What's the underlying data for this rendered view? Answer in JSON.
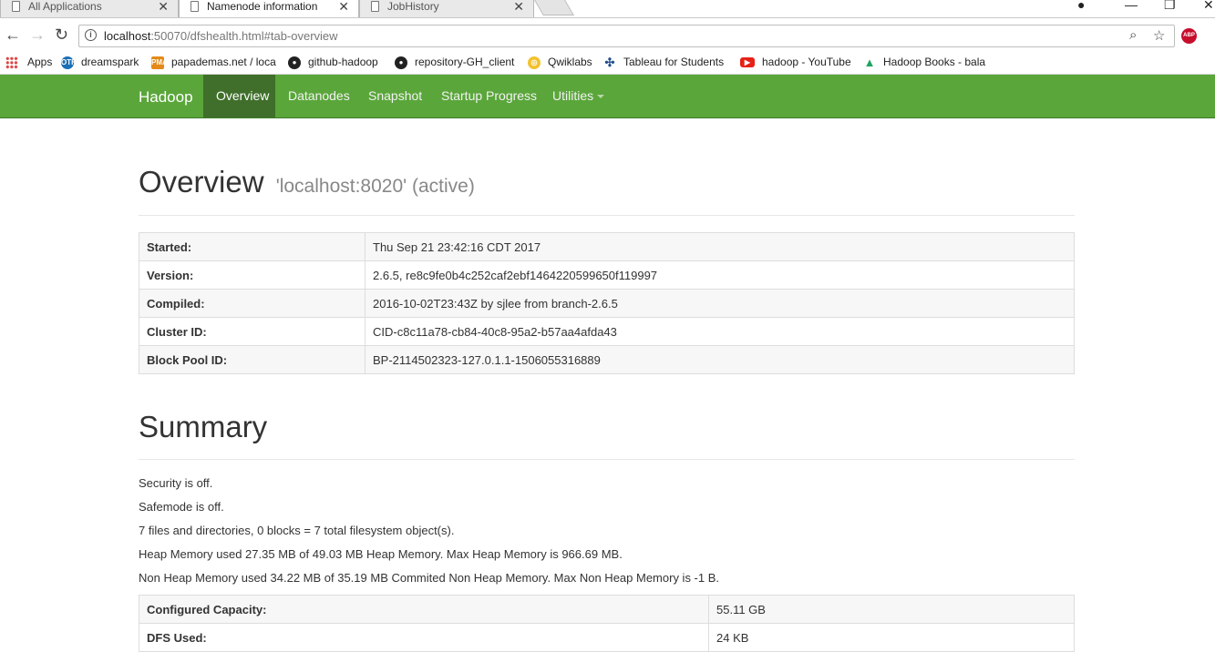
{
  "browser": {
    "tabs": [
      {
        "title": "All Applications",
        "active": false
      },
      {
        "title": "Namenode information",
        "active": true
      },
      {
        "title": "JobHistory",
        "active": false
      }
    ],
    "url_host": "localhost",
    "url_path": ":50070/dfshealth.html#tab-overview",
    "abp_label": "ABP",
    "bookmarks": [
      {
        "label": "Apps",
        "icon": "apps-grid-icon"
      },
      {
        "label": "dreamspark",
        "icon": "dreamspark-icon",
        "badge": "OTH"
      },
      {
        "label": "papademas.net / loca",
        "icon": "pma-icon",
        "badge": "PMA"
      },
      {
        "label": "github-hadoop",
        "icon": "github-icon"
      },
      {
        "label": "repository-GH_client",
        "icon": "github-icon"
      },
      {
        "label": "Qwiklabs",
        "icon": "qwiklabs-icon"
      },
      {
        "label": "Tableau for Students",
        "icon": "tableau-icon"
      },
      {
        "label": "hadoop - YouTube",
        "icon": "youtube-icon"
      },
      {
        "label": "Hadoop Books - bala",
        "icon": "google-drive-icon"
      }
    ]
  },
  "navbar": {
    "brand": "Hadoop",
    "items": [
      {
        "label": "Overview",
        "active": true
      },
      {
        "label": "Datanodes",
        "active": false
      },
      {
        "label": "Snapshot",
        "active": false
      },
      {
        "label": "Startup Progress",
        "active": false
      },
      {
        "label": "Utilities",
        "active": false,
        "dropdown": true
      }
    ],
    "color": "#5aa63a"
  },
  "overview": {
    "title": "Overview",
    "subtitle": "'localhost:8020' (active)",
    "rows": [
      {
        "key": "Started:",
        "value": "Thu Sep 21 23:42:16 CDT 2017"
      },
      {
        "key": "Version:",
        "value": "2.6.5, re8c9fe0b4c252caf2ebf1464220599650f119997"
      },
      {
        "key": "Compiled:",
        "value": "2016-10-02T23:43Z by sjlee from branch-2.6.5"
      },
      {
        "key": "Cluster ID:",
        "value": "CID-c8c11a78-cb84-40c8-95a2-b57aa4afda43"
      },
      {
        "key": "Block Pool ID:",
        "value": "BP-2114502323-127.0.1.1-1506055316889"
      }
    ]
  },
  "summary": {
    "title": "Summary",
    "lines": [
      "Security is off.",
      "Safemode is off.",
      "7 files and directories, 0 blocks = 7 total filesystem object(s).",
      "Heap Memory used 27.35 MB of 49.03 MB Heap Memory. Max Heap Memory is 966.69 MB.",
      "Non Heap Memory used 34.22 MB of 35.19 MB Commited Non Heap Memory. Max Non Heap Memory is -1 B."
    ],
    "rows": [
      {
        "key": "Configured Capacity:",
        "value": "55.11 GB"
      },
      {
        "key": "DFS Used:",
        "value": "24 KB"
      }
    ]
  }
}
